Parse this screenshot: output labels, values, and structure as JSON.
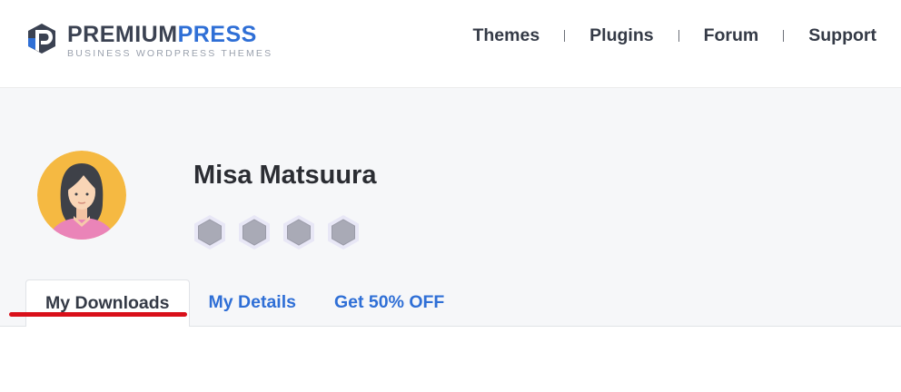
{
  "brand": {
    "name_part1": "PREMIUM",
    "name_part2": "PRESS",
    "tagline": "BUSINESS WORDPRESS THEMES",
    "primary_color": "#2f6fd6",
    "dark_color": "#3b4252"
  },
  "nav": {
    "items": [
      {
        "label": "Themes"
      },
      {
        "label": "Plugins"
      },
      {
        "label": "Forum"
      },
      {
        "label": "Support"
      }
    ]
  },
  "profile": {
    "name": "Misa Matsuura",
    "avatar_icon": "female-user-avatar-icon",
    "badges": [
      {
        "icon": "hexagon-badge-icon"
      },
      {
        "icon": "hexagon-badge-icon"
      },
      {
        "icon": "hexagon-badge-icon"
      },
      {
        "icon": "hexagon-badge-icon"
      }
    ]
  },
  "tabs": {
    "items": [
      {
        "label": "My Downloads",
        "active": true
      },
      {
        "label": "My Details",
        "active": false
      },
      {
        "label": "Get 50% OFF",
        "active": false
      }
    ]
  },
  "colors": {
    "active_underline": "#d9101a",
    "profile_bg": "#f6f7f9",
    "tab_link": "#2f6fd6"
  }
}
